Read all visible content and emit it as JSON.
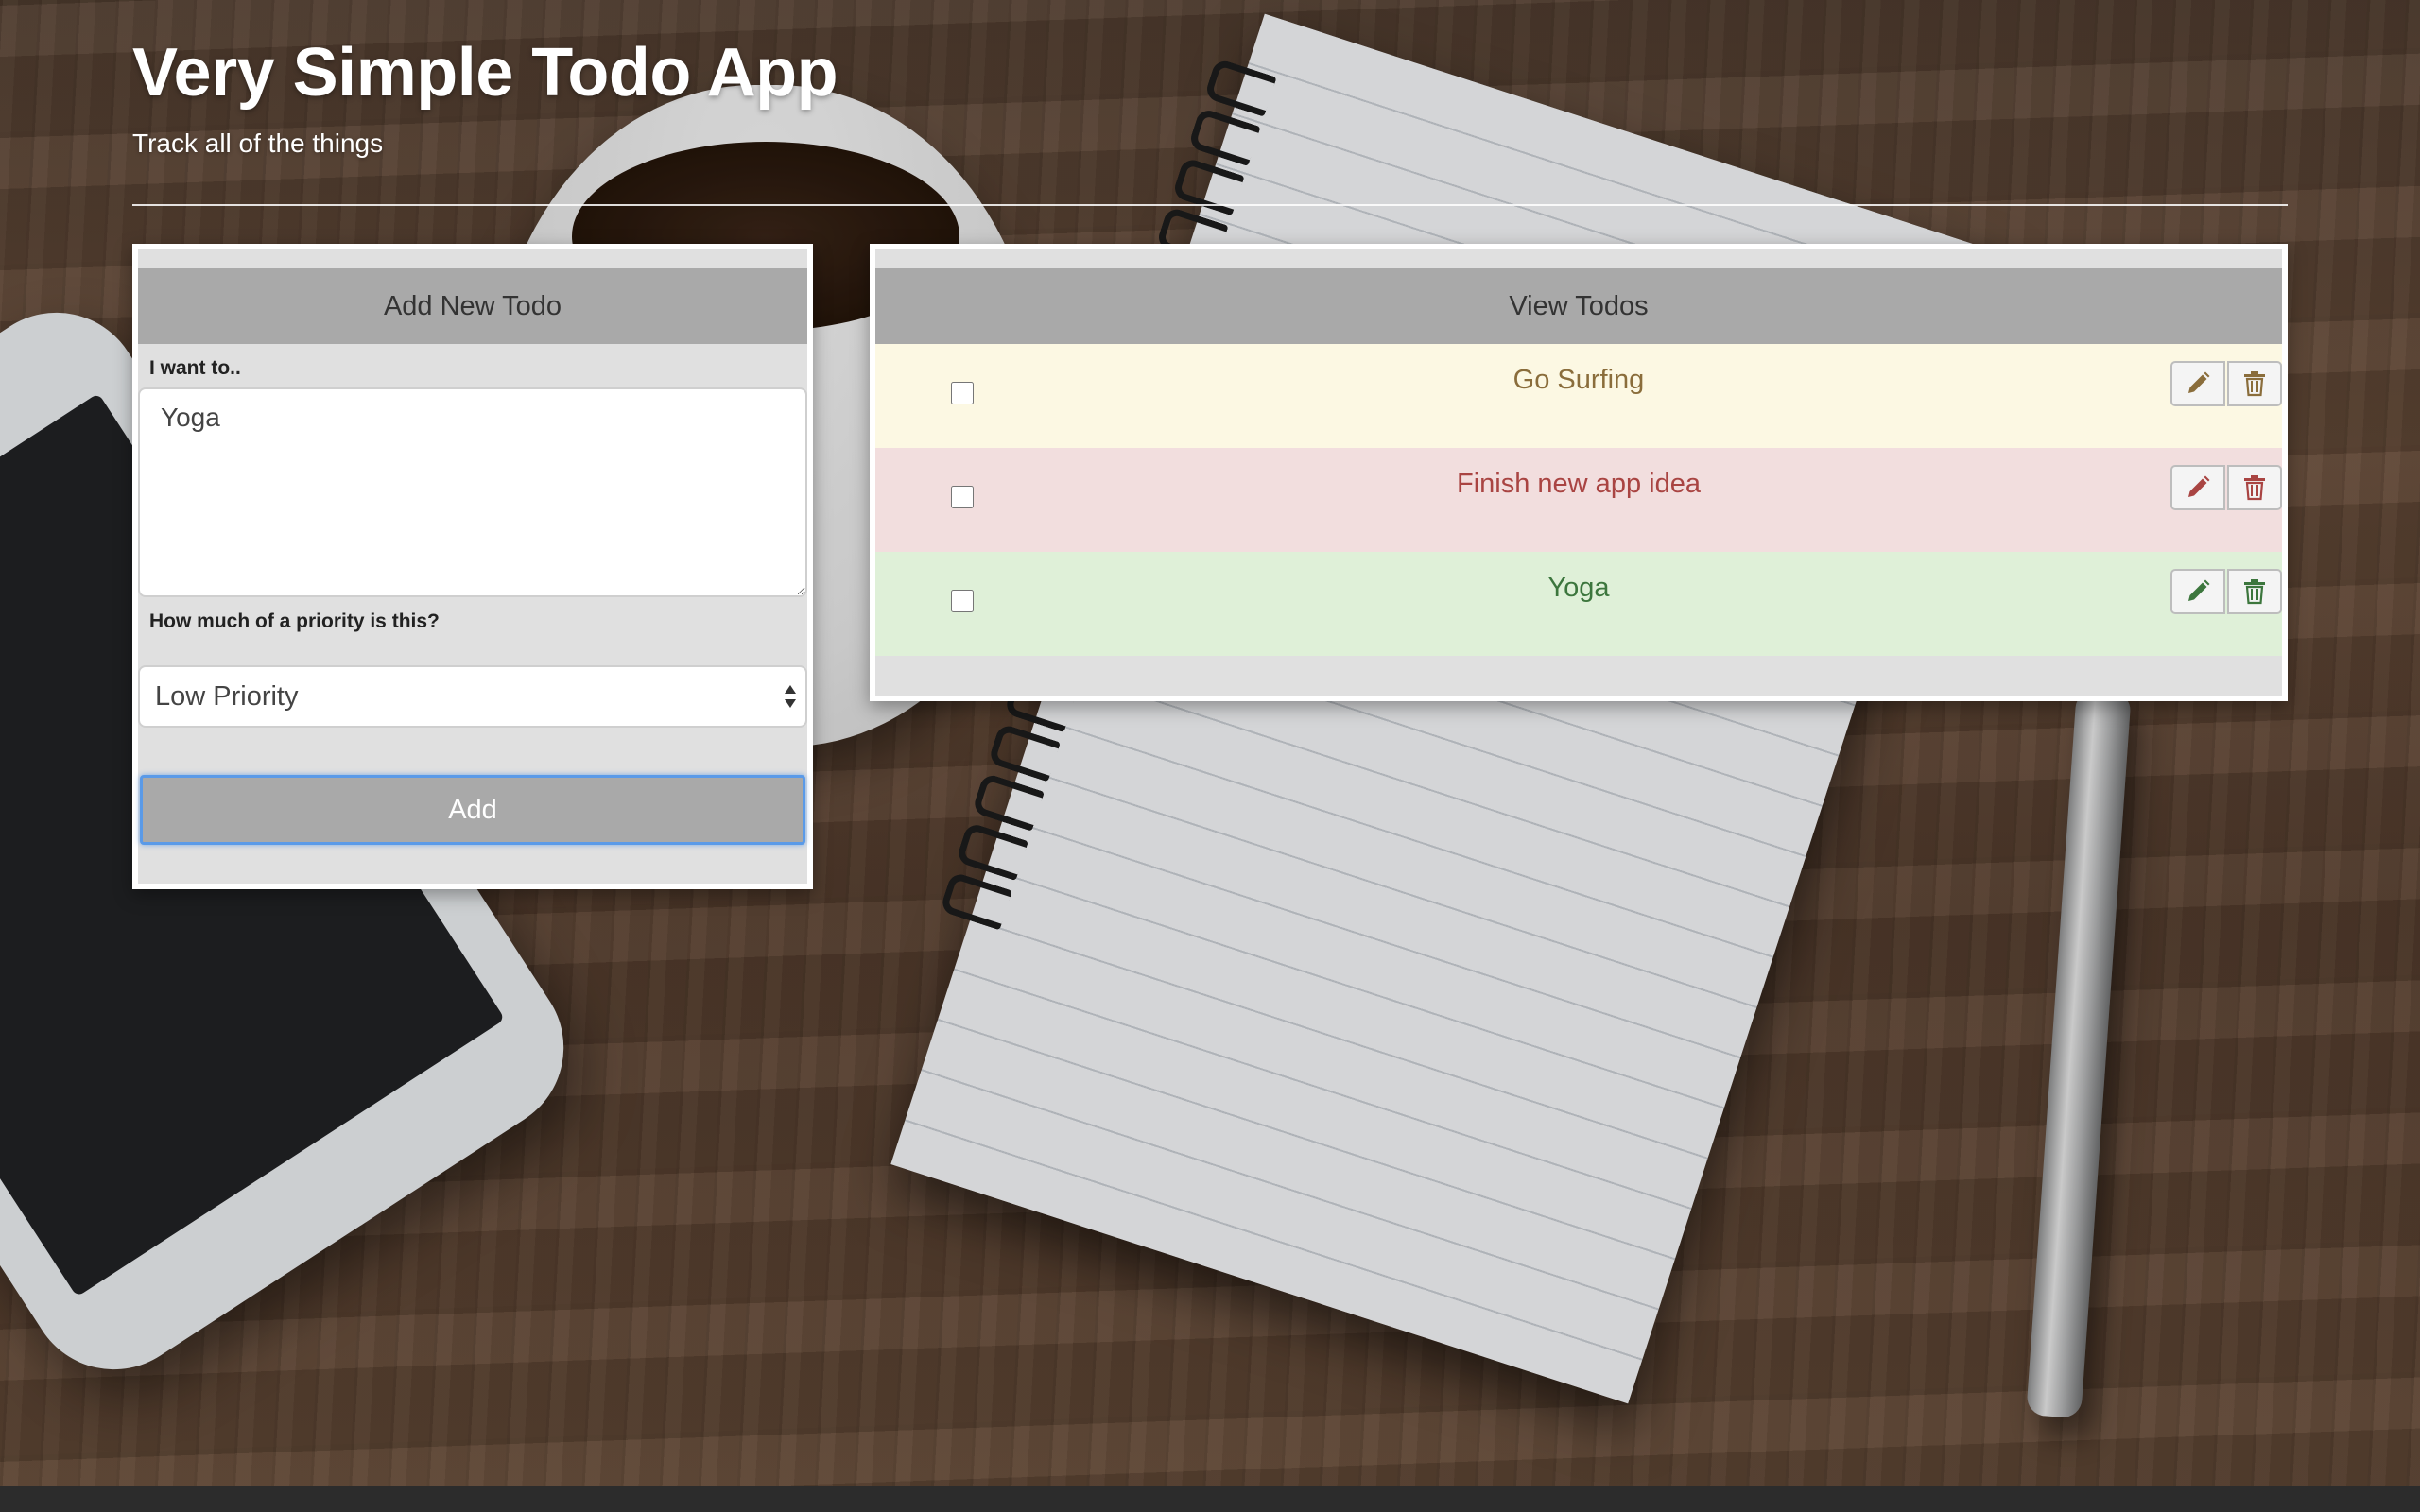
{
  "header": {
    "title": "Very Simple Todo App",
    "subtitle": "Track all of the things"
  },
  "add_panel": {
    "heading": "Add New Todo",
    "text_label": "I want to..",
    "text_value": "Yoga",
    "priority_label": "How much of a priority is this?",
    "priority_selected": "Low Priority",
    "add_label": "Add"
  },
  "view_panel": {
    "heading": "View Todos",
    "todos": [
      {
        "text": "Go Surfing",
        "checked": false,
        "bg": "#fcf8e3",
        "color": "#8a6d3b"
      },
      {
        "text": "Finish new app idea",
        "checked": false,
        "bg": "#f2dede",
        "color": "#a94442"
      },
      {
        "text": "Yoga",
        "checked": false,
        "bg": "#dff0d8",
        "color": "#3c763d"
      }
    ]
  },
  "colors": {
    "panel_header": "#a9a9a9",
    "panel_body": "#e0e0e0",
    "focus_ring": "#5a9ae8"
  },
  "icons": {
    "edit": "pencil-icon",
    "delete": "trash-icon",
    "select": "chevron-updown-icon"
  }
}
